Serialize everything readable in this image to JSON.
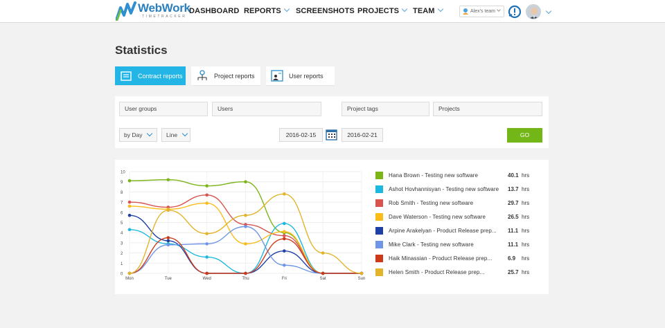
{
  "header": {
    "logo_title": "WebWork",
    "logo_subtitle": "TIMETRACKER",
    "nav": [
      {
        "label": "DASHBOARD",
        "dropdown": false
      },
      {
        "label": "REPORTS",
        "dropdown": true
      },
      {
        "label": "SCREENSHOTS",
        "dropdown": false
      },
      {
        "label": "PROJECTS",
        "dropdown": true
      },
      {
        "label": "TEAM",
        "dropdown": true
      }
    ],
    "team_selector": "Alex's team",
    "icons": [
      "team-pin-icon",
      "alert-icon",
      "avatar",
      "chevron-down-icon"
    ]
  },
  "page_title": "Statistics",
  "tabs": [
    {
      "label": "Contract reports",
      "icon": "contract-report-icon",
      "active": true
    },
    {
      "label": "Project reports",
      "icon": "project-report-icon",
      "active": false
    },
    {
      "label": "User reports",
      "icon": "user-report-icon",
      "active": false
    }
  ],
  "filters": {
    "user_groups_placeholder": "User groups",
    "users_placeholder": "Users",
    "project_tags_placeholder": "Project tags",
    "projects_placeholder": "Projects",
    "period_select": "by Day",
    "chart_type_select": "Line",
    "date_from": "2016-02-15",
    "date_to": "2016-02-21",
    "go_label": "GO"
  },
  "colors": {
    "accent": "#22b5e6",
    "go": "#72b617",
    "brand": "#2a7fbf"
  },
  "chart_data": {
    "type": "line",
    "categories": [
      "Mon",
      "Tue",
      "Wed",
      "Thu",
      "Fri",
      "Sat",
      "Sun"
    ],
    "y_ticks": [
      "0",
      "1",
      "2",
      "3",
      "4",
      "5",
      "6",
      "7",
      "8",
      "9",
      "10"
    ],
    "ylim": [
      0,
      10
    ],
    "grid": true,
    "legend_position": "right",
    "series": [
      {
        "name": "Hana Brown - Testing new software",
        "total": "40.1",
        "unit": "hrs",
        "color": "#7cb518",
        "values": [
          9.1,
          9.2,
          8.6,
          9.0,
          4.0,
          0,
          0
        ]
      },
      {
        "name": "Ashot Hovhannisyan - Testing new software",
        "total": "13.7",
        "unit": "hrs",
        "color": "#1cb8e0",
        "values": [
          4.3,
          2.9,
          1.6,
          0,
          4.9,
          0,
          0
        ]
      },
      {
        "name": "Rob Smith - Testing new software",
        "total": "29.7",
        "unit": "hrs",
        "color": "#d9534f",
        "values": [
          7.0,
          6.5,
          7.7,
          4.8,
          3.7,
          0,
          0
        ]
      },
      {
        "name": "Dave Waterson - Testing new software",
        "total": "26.5",
        "unit": "hrs",
        "color": "#fbbc1a",
        "values": [
          6.6,
          6.3,
          6.9,
          2.9,
          4.1,
          0,
          0
        ]
      },
      {
        "name": "Arpine Arakelyan - Product Release prep...",
        "total": "11.1",
        "unit": "hrs",
        "color": "#1d3fa6",
        "values": [
          5.7,
          3.2,
          0,
          0,
          2.2,
          0,
          0
        ]
      },
      {
        "name": "Mike Clark - Testing new software",
        "total": "11.1",
        "unit": "hrs",
        "color": "#6f96e6",
        "values": [
          0,
          2.8,
          2.9,
          4.6,
          0.8,
          0,
          0
        ]
      },
      {
        "name": "Haik Minassian - Product Release prep...",
        "total": "6.9",
        "unit": "hrs",
        "color": "#cc3a1a",
        "values": [
          0,
          3.5,
          0,
          0,
          3.4,
          0,
          0
        ]
      },
      {
        "name": "Helen Smith - Product Release prep...",
        "total": "25.7",
        "unit": "hrs",
        "color": "#e2b42a",
        "values": [
          0,
          6.2,
          3.9,
          5.7,
          7.8,
          2.0,
          0
        ]
      }
    ]
  }
}
